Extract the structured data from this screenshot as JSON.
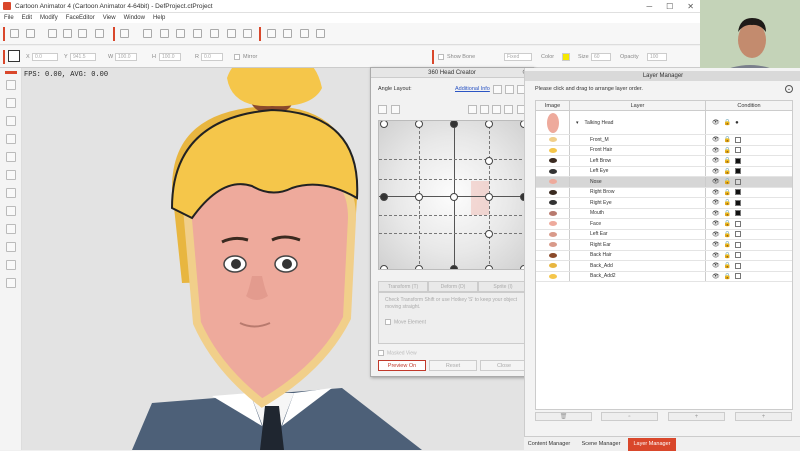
{
  "window": {
    "title": "Cartoon Animator 4  (Cartoon Animator 4-64bit) - DefProject.ctProject",
    "min": "─",
    "max": "☐",
    "close": "✕"
  },
  "menu": [
    "File",
    "Edit",
    "Modify",
    "FaceEditor",
    "View",
    "Window",
    "Help"
  ],
  "toolbar2": {
    "x_label": "X",
    "x_value": "0.0",
    "y_label": "Y",
    "y_value": "941.5",
    "w_label": "W",
    "w_value": "100.0",
    "h_label": "H",
    "h_value": "100.0",
    "r_label": "R",
    "r_value": "0.0",
    "mirror_label": "Mirror",
    "show_bone_label": "Show Bone",
    "mode_value": "Fixed",
    "color_label": "Color",
    "color_value": "#f5e800",
    "size_label": "Size",
    "size_value": "60",
    "opacity_label": "Opacity",
    "opacity_value": "100"
  },
  "canvas": {
    "fps": "FPS: 0.00, AVG: 0.00"
  },
  "head_creator": {
    "title": "360 Head Creator",
    "close": "⊗",
    "angle_label": "Angle Layout:",
    "additional_info": "Additional Info",
    "tab_transform": "Transform (T)",
    "tab_deform": "Deform (D)",
    "tab_sprite": "Sprite (I)",
    "hint": "Check Transform Shift or use Hotkey 'S' to keep your object moving straight.",
    "move_element": "Move Element",
    "masked_view": "Masked View",
    "preview": "Preview On",
    "reset": "Reset",
    "close_btn": "Close"
  },
  "layer_manager": {
    "title": "Layer Manager",
    "instruction": "Please click and drag to arrange layer order.",
    "col_image": "Image",
    "col_layer": "Layer",
    "col_condition": "Condition",
    "root": "Talking Head",
    "layers": [
      {
        "name": "Front_M",
        "cond": "mini"
      },
      {
        "name": "Front Hair",
        "cond": "mini"
      },
      {
        "name": "Left Brow",
        "cond": "blk"
      },
      {
        "name": "Left Eye",
        "cond": "blk"
      },
      {
        "name": "Nose",
        "cond": "mini"
      },
      {
        "name": "Right Brow",
        "cond": "blk"
      },
      {
        "name": "Right Eye",
        "cond": "blk"
      },
      {
        "name": "Mouth",
        "cond": "blk"
      },
      {
        "name": "Face",
        "cond": "mini"
      },
      {
        "name": "Left Ear",
        "cond": "mini"
      },
      {
        "name": "Right Ear",
        "cond": "mini"
      },
      {
        "name": "Back Hair",
        "cond": "mini"
      },
      {
        "name": "Back_Add",
        "cond": "mini"
      },
      {
        "name": "Back_Add2",
        "cond": "mini"
      }
    ],
    "selected": "Nose"
  },
  "tabs": {
    "content": "Content Manager",
    "scene": "Scene Manager",
    "layer": "Layer Manager"
  },
  "colors": {
    "accent": "#d9472b",
    "hair": "#f5c64a",
    "skin": "#eeaa9c",
    "suit": "#4d6078"
  }
}
